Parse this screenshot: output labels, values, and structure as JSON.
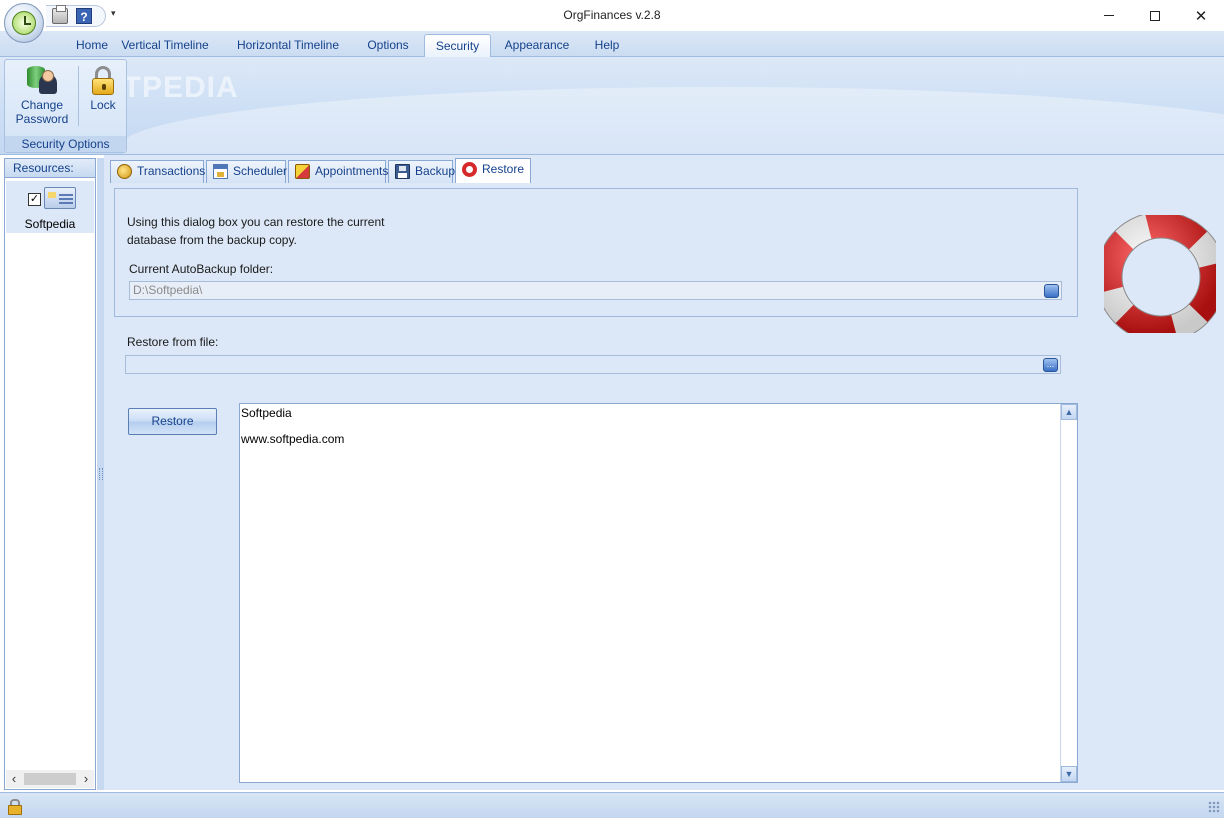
{
  "window": {
    "title": "OrgFinances v.2.8",
    "minimize": "",
    "maximize": "",
    "close": "✕"
  },
  "quick_access": {
    "icons": [
      "printer-icon",
      "help-icon"
    ],
    "help_glyph": "?",
    "dropdown_glyph": "▾"
  },
  "ribbon": {
    "tabs": [
      "Home",
      "Vertical Timeline",
      "Horizontal Timeline",
      "Options",
      "Security",
      "Appearance",
      "Help"
    ],
    "active_tab": "Security",
    "group": {
      "caption": "Security Options",
      "change_password_line1": "Change",
      "change_password_line2": "Password",
      "lock_label": "Lock"
    },
    "watermark": "SOFTPEDIA"
  },
  "resources": {
    "header": "Resources:",
    "item": {
      "label": "Softpedia",
      "checked": true,
      "check_glyph": "✓"
    },
    "scroll_left": "‹",
    "scroll_right": "›"
  },
  "doc_tabs": {
    "items": [
      {
        "label": "Transactions",
        "icon": "coins-icon"
      },
      {
        "label": "Scheduler",
        "icon": "calendar-icon"
      },
      {
        "label": "Appointments",
        "icon": "appointments-icon"
      },
      {
        "label": "Backup",
        "icon": "floppy-icon"
      },
      {
        "label": "Restore",
        "icon": "lifebuoy-icon"
      }
    ],
    "active": "Restore"
  },
  "restore_page": {
    "description_line1": "Using this dialog box you can restore the current",
    "description_line2": "database from the backup copy.",
    "autobackup_label": "Current AutoBackup folder:",
    "autobackup_value": "D:\\Softpedia\\",
    "restore_from_label": "Restore from file:",
    "restore_from_value": "",
    "browse_glyph": "...",
    "restore_button": "Restore",
    "notes_line1": "Softpedia",
    "notes_line2": "www.softpedia.com",
    "scroll_up": "▲",
    "scroll_down": "▼"
  },
  "colors": {
    "accent": "#15428b",
    "panel": "#dce8f7",
    "lifebuoy_red": "#d62a2a"
  }
}
